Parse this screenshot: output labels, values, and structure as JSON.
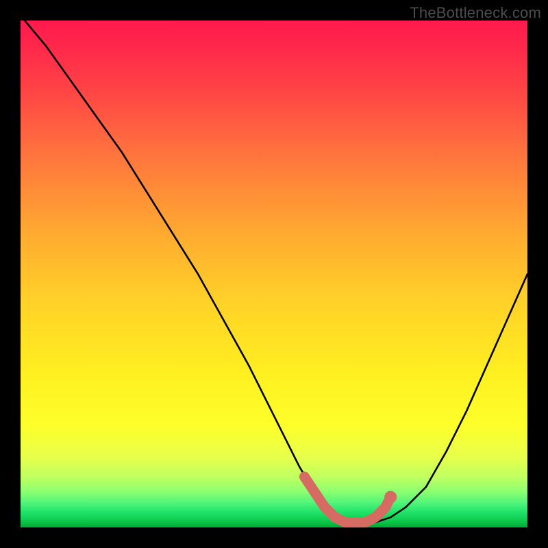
{
  "watermark": "TheBottleneck.com",
  "chart_data": {
    "type": "line",
    "title": "",
    "xlabel": "",
    "ylabel": "",
    "xlim": [
      0,
      100
    ],
    "ylim": [
      0,
      100
    ],
    "grid": false,
    "legend": false,
    "background": {
      "kind": "vertical-gradient",
      "top_color": "#ff1a4d",
      "bottom_color": "#03a637"
    },
    "series": [
      {
        "name": "bottleneck-curve",
        "color": "#000000",
        "x": [
          0,
          5,
          10,
          15,
          20,
          25,
          30,
          35,
          40,
          45,
          50,
          55,
          58,
          60,
          63,
          66,
          70,
          73,
          76,
          80,
          84,
          88,
          92,
          96,
          100
        ],
        "values": [
          101,
          95,
          88,
          81,
          74,
          66,
          58,
          50,
          41,
          32,
          22,
          12,
          7,
          4,
          2,
          1,
          1,
          2,
          4,
          8,
          15,
          23,
          32,
          41,
          50
        ]
      },
      {
        "name": "highlight-band",
        "kind": "marker",
        "color": "#d66b63",
        "x": [
          56,
          58,
          60,
          62,
          64,
          66,
          68,
          70,
          72,
          73
        ],
        "values": [
          10,
          7,
          4,
          2,
          1,
          1,
          1,
          2,
          4,
          6
        ]
      }
    ]
  }
}
